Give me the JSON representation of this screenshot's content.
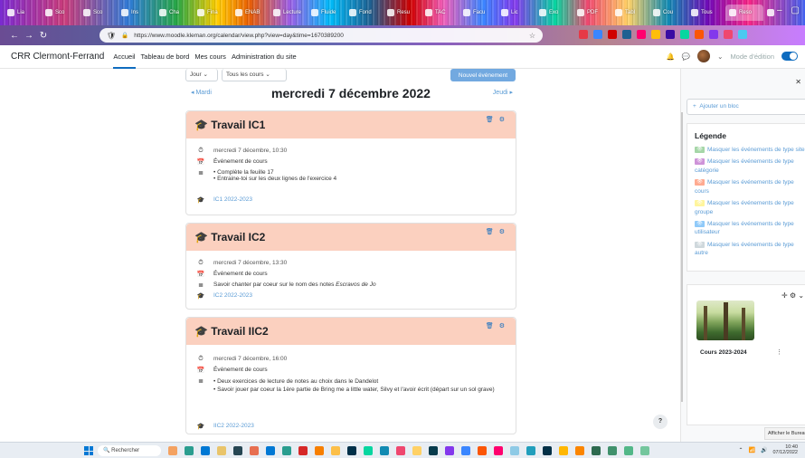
{
  "browser": {
    "tabs": [
      "Lia",
      "Sco",
      "Sco",
      "Ins",
      "Cha",
      "Fina",
      "ENAB",
      "Lecture",
      "Fluide",
      "Fond",
      "Resu",
      "TAC",
      "Facu",
      "Lic",
      "Exo",
      "PDF",
      "Tabl",
      "Cou",
      "Tous",
      "Reso",
      ""
    ],
    "url": "https://www.moodle.kleman.org/calendar/view.php?view=day&time=1670389200",
    "ext_colors": [
      "#e63946",
      "#3a86ff",
      "#d00000",
      "#1e6091",
      "#ff006e",
      "#ffbe0b",
      "#3a0ca3",
      "#06d6a0",
      "#fb5607",
      "#8338ec",
      "#ef476f",
      "#4cc9f0"
    ]
  },
  "header": {
    "brand": "CRR Clermont-Ferrand",
    "nav": [
      "Accueil",
      "Tableau de bord",
      "Mes cours",
      "Administration du site"
    ],
    "edit_mode_label": "Mode d'édition"
  },
  "calendar": {
    "view_select": "Jour",
    "course_select": "Tous les cours",
    "new_event_button": "Nouvel événement",
    "prev_day": "Mardi",
    "next_day": "Jeudi",
    "day_title": "mercredi 7 décembre 2022"
  },
  "events": [
    {
      "title": "Travail IC1",
      "time": "mercredi 7 décembre, 10:30",
      "type": "Événement de cours",
      "description": [
        "Complète la feuille 17",
        "Entraine-toi sur les deux lignes de l'exercice 4"
      ],
      "course": "IC1 2022-2023"
    },
    {
      "title": "Travail IC2",
      "time": "mercredi 7 décembre, 13:30",
      "type": "Événement de cours",
      "description_plain": "Savoir chanter par coeur sur le nom des notes",
      "description_italic": "Escravos de Jo",
      "course": "IC2 2022-2023"
    },
    {
      "title": "Travail IIC2",
      "time": "mercredi 7 décembre, 16:00",
      "type": "Événement de cours",
      "description": [
        "Deux exercices de lecture de notes au choix dans le Dandelot",
        "Savoir jouer par coeur la 1ère partie de Bring me a little water, Silvy et l'avoir écrit (départ sur un sol grave)"
      ],
      "course": "IIC2 2022-2023"
    }
  ],
  "drawer": {
    "add_block": "Ajouter un bloc",
    "legend_title": "Légende",
    "legend_items": [
      {
        "label": "Masquer les événements de type site",
        "color": "#a5d6a7"
      },
      {
        "label": "Masquer les événements de type catégorie",
        "color": "#ce93d8"
      },
      {
        "label": "Masquer les événements de type cours",
        "color": "#ffab91"
      },
      {
        "label": "Masquer les événements de type groupe",
        "color": "#fff59d"
      },
      {
        "label": "Masquer les événements de type utilisateur",
        "color": "#90caf9"
      },
      {
        "label": "Masquer les événements de type autre",
        "color": "#cfd8dc"
      }
    ],
    "course_name": "Cours 2023-2024",
    "tooltip": "Afficher le Bureau"
  },
  "taskbar": {
    "search_placeholder": "Rechercher",
    "time": "10:40",
    "date": "07/12/2022",
    "icon_colors": [
      "#f4a261",
      "#2a9d8f",
      "#0078d4",
      "#e9c46a",
      "#264653",
      "#e76f51",
      "#0078d4",
      "#2a9d8f",
      "#d62828",
      "#f77f00",
      "#fcbf49",
      "#003049",
      "#06d6a0",
      "#118ab2",
      "#ef476f",
      "#ffd166",
      "#073b4c",
      "#8338ec",
      "#3a86ff",
      "#fb5607",
      "#ff006e",
      "#8ecae6",
      "#219ebc",
      "#023047",
      "#ffb703",
      "#fb8500",
      "#2d6a4f",
      "#40916c",
      "#52b788",
      "#74c69d"
    ]
  }
}
